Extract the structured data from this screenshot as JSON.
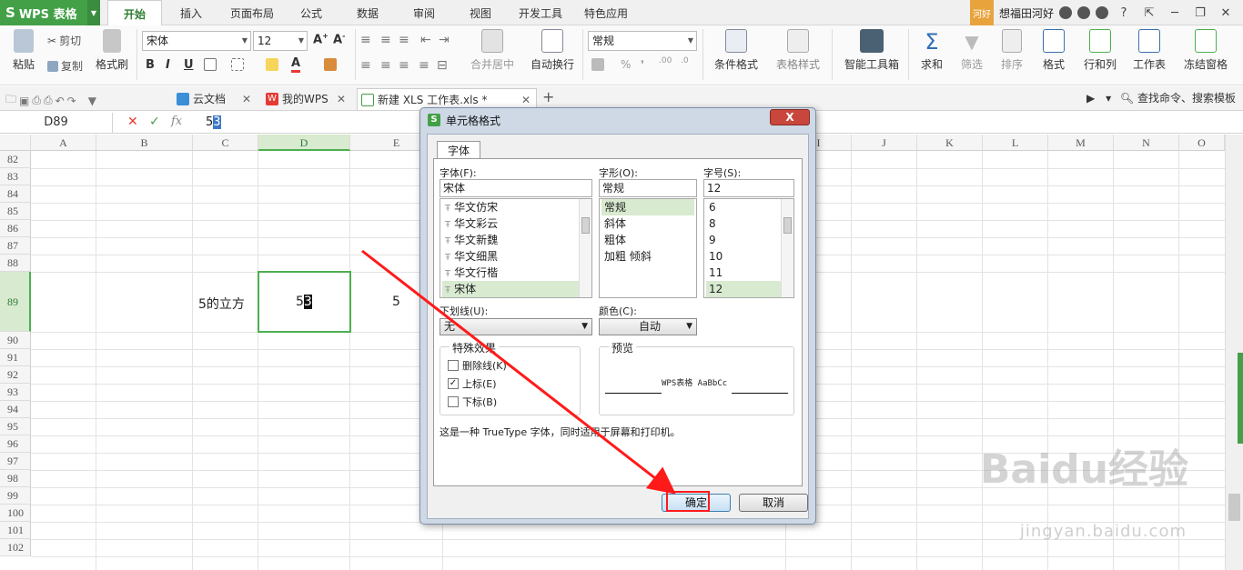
{
  "app": {
    "name": "WPS 表格",
    "logo": "S"
  },
  "menu": [
    "开始",
    "插入",
    "页面布局",
    "公式",
    "数据",
    "审阅",
    "视图",
    "开发工具",
    "特色应用"
  ],
  "user": {
    "avatar_label": "河好",
    "name": "想福田河好"
  },
  "ribbon": {
    "paste": "粘贴",
    "cut": "剪切",
    "copy": "复制",
    "format_painter": "格式刷",
    "font_name": "宋体",
    "font_size": "12",
    "bold": "B",
    "italic": "I",
    "underline": "U",
    "font_color_glyph": "A",
    "merge_center": "合并居中",
    "wrap": "自动换行",
    "number_format": "常规",
    "percent": "%",
    "cond_format": "条件格式",
    "table_style": "表格样式",
    "smart_tools": "智能工具箱",
    "sum": "求和",
    "filter": "筛选",
    "sort": "排序",
    "format": "格式",
    "rows_cols": "行和列",
    "worksheet": "工作表",
    "freeze": "冻结窗格"
  },
  "tabs": [
    {
      "label": "云文档"
    },
    {
      "label": "我的WPS"
    },
    {
      "label": "新建 XLS 工作表.xls *"
    }
  ],
  "search_command": "查找命令、搜索模板",
  "formula": {
    "name_box": "D89",
    "fx": "fx",
    "value_prefix": "5",
    "value_selected": "3"
  },
  "columns": [
    "A",
    "B",
    "C",
    "D",
    "E",
    "I",
    "J",
    "K",
    "L",
    "M",
    "N",
    "O"
  ],
  "rows": [
    "82",
    "83",
    "84",
    "85",
    "86",
    "87",
    "88",
    "89",
    "90",
    "91",
    "92",
    "93",
    "94",
    "95",
    "96",
    "97",
    "98",
    "99",
    "100",
    "101",
    "102"
  ],
  "cells": {
    "c89": "5的立方",
    "d89_prefix": "5",
    "d89_sup": "3",
    "e89": "5"
  },
  "dialog": {
    "title": "单元格格式",
    "close": "X",
    "tab": "字体",
    "font_label": "字体(F):",
    "font_value": "宋体",
    "font_list": [
      "华文仿宋",
      "华文彩云",
      "华文新魏",
      "华文细黑",
      "华文行楷",
      "宋体"
    ],
    "style_label": "字形(O):",
    "style_value": "常规",
    "style_list": [
      "常规",
      "斜体",
      "粗体",
      "加粗 倾斜"
    ],
    "size_label": "字号(S):",
    "size_value": "12",
    "size_list": [
      "6",
      "8",
      "9",
      "10",
      "11",
      "12"
    ],
    "underline_label": "下划线(U):",
    "underline_value": "无",
    "color_label": "颜色(C):",
    "color_value": "自动",
    "effects_label": "特殊效果",
    "strikethrough": "删除线(K)",
    "superscript": "上标(E)",
    "subscript": "下标(B)",
    "preview_label": "预览",
    "preview_text": "WPS表格  AaBbCc",
    "note": "这是一种 TrueType 字体，同时适用于屏幕和打印机。",
    "ok": "确定",
    "cancel": "取消"
  },
  "watermark": {
    "brand": "Baidu经验",
    "url": "jingyan.baidu.com"
  },
  "colors": {
    "accent": "#43a047",
    "annotation": "#ff1a1a",
    "selection": "#d8ead0"
  }
}
